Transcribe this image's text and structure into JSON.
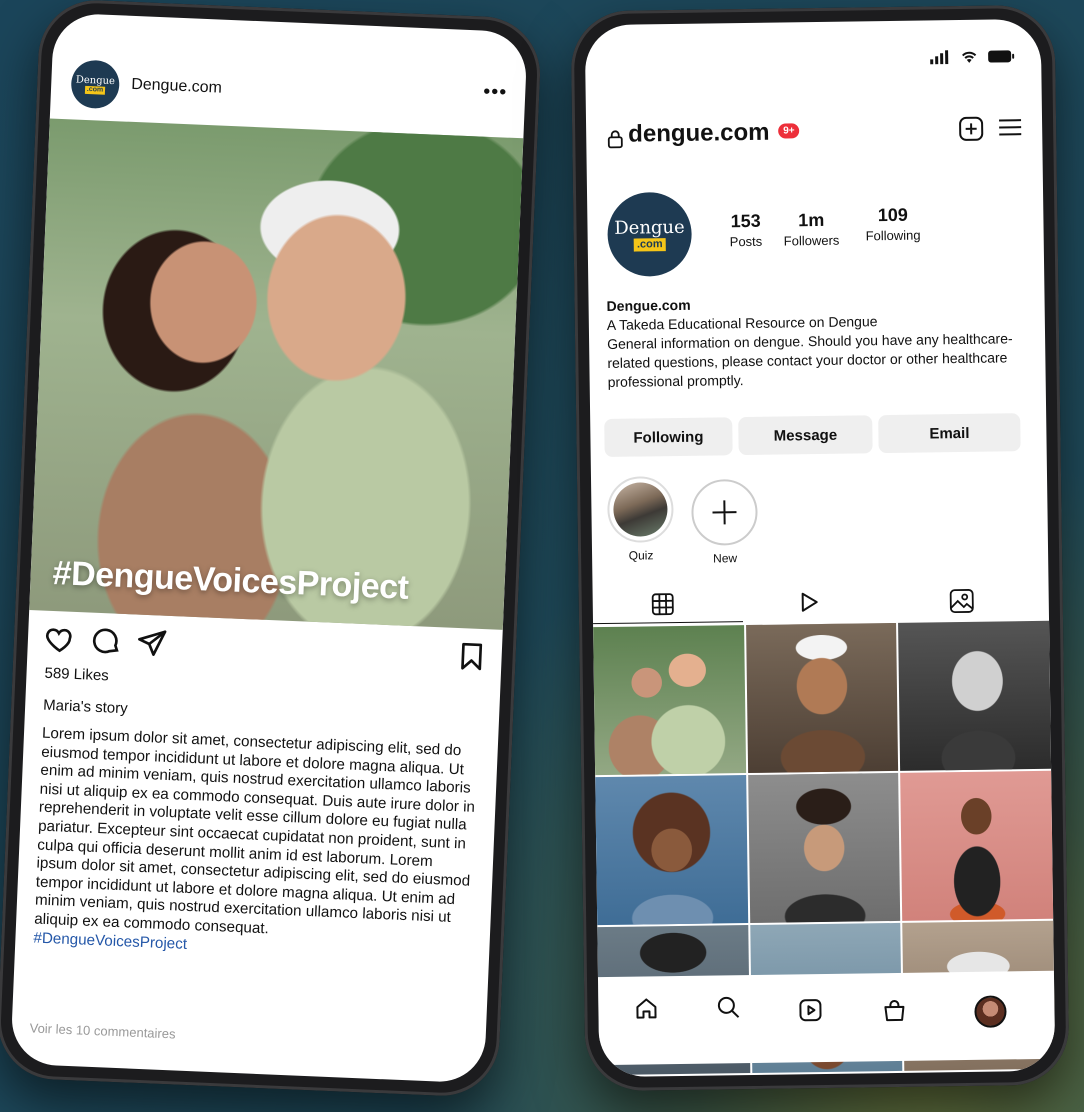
{
  "post": {
    "handle": "Dengue.com",
    "avatar_word": "Dengue",
    "avatar_suffix": ".com",
    "more": "•••",
    "photo_hashtag": "#DengueVoicesProject",
    "likes": "589 Likes",
    "story_title": "Maria's story",
    "caption": "Lorem ipsum dolor sit amet, consectetur adipiscing elit, sed do eiusmod tempor incididunt ut labore et dolore magna aliqua. Ut enim ad minim veniam, quis nostrud exercitation ullamco laboris nisi ut aliquip ex ea commodo consequat. Duis aute irure dolor in reprehenderit in voluptate velit esse cillum dolore eu fugiat nulla pariatur. Excepteur sint occaecat cupidatat non proident, sunt in culpa qui officia deserunt mollit anim id est laborum. Lorem ipsum dolor sit amet, consectetur adipiscing elit, sed do eiusmod tempor incididunt ut labore et dolore magna aliqua. Ut enim ad minim veniam, quis nostrud exercitation ullamco laboris nisi ut aliquip ex ea commodo consequat.",
    "caption_hashtag": "#DengueVoicesProject",
    "comments": "Voir les 10 commentaires",
    "icons": [
      "heart-icon",
      "comment-icon",
      "share-icon",
      "bookmark-icon"
    ]
  },
  "profile": {
    "handle": "dengue.com",
    "badge": "9+",
    "avatar_word": "Dengue",
    "avatar_suffix": ".com",
    "stats": [
      {
        "value": "153",
        "label": "Posts"
      },
      {
        "value": "1m",
        "label": "Followers"
      },
      {
        "value": "109",
        "label": "Following"
      }
    ],
    "bio": {
      "name": "Dengue.com",
      "line1": "A Takeda Educational Resource on Dengue",
      "line2": "General information on dengue. Should you have any healthcare-related questions, please contact your doctor or other healthcare professional promptly."
    },
    "buttons": {
      "following": "Following",
      "message": "Message",
      "email": "Email"
    },
    "highlights": [
      {
        "label": "Quiz"
      },
      {
        "label": "New"
      }
    ],
    "tabs": [
      "grid-icon",
      "reels-icon",
      "tagged-icon"
    ],
    "nav": [
      "home-icon",
      "search-icon",
      "reels-icon",
      "shop-icon",
      "profile-avatar"
    ]
  },
  "colors": {
    "brand_navy": "#1e3a52",
    "brand_yellow": "#f5c518",
    "badge_red": "#ed2f3a",
    "link_blue": "#2457a8",
    "button_gray": "#efefef"
  }
}
